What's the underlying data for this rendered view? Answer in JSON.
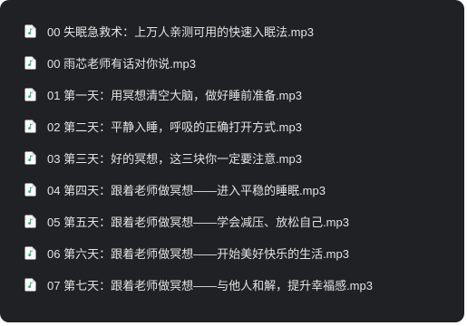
{
  "files": [
    {
      "name": "00 失眠急救术：上万人亲测可用的快速入眠法.mp3",
      "icon": "audio-file-icon"
    },
    {
      "name": "00 雨芯老师有话对你说.mp3",
      "icon": "audio-file-icon"
    },
    {
      "name": "01 第一天：用冥想清空大脑，做好睡前准备.mp3",
      "icon": "audio-file-icon"
    },
    {
      "name": "02 第二天：平静入睡，呼吸的正确打开方式.mp3",
      "icon": "audio-file-icon"
    },
    {
      "name": "03 第三天：好的冥想，这三块你一定要注意.mp3",
      "icon": "audio-file-icon"
    },
    {
      "name": "04 第四天：跟着老师做冥想——进入平稳的睡眠.mp3",
      "icon": "audio-file-icon"
    },
    {
      "name": "05 第五天：跟着老师做冥想——学会减压、放松自己.mp3",
      "icon": "audio-file-icon"
    },
    {
      "name": "06 第六天：跟着老师做冥想——开始美好快乐的生活.mp3",
      "icon": "audio-file-icon"
    },
    {
      "name": "07 第七天：跟着老师做冥想——与他人和解，提升幸福感.mp3",
      "icon": "audio-file-icon"
    }
  ],
  "colors": {
    "background": "#202124",
    "text": "#e3e3e3",
    "icon_accent": "#20b36b"
  }
}
